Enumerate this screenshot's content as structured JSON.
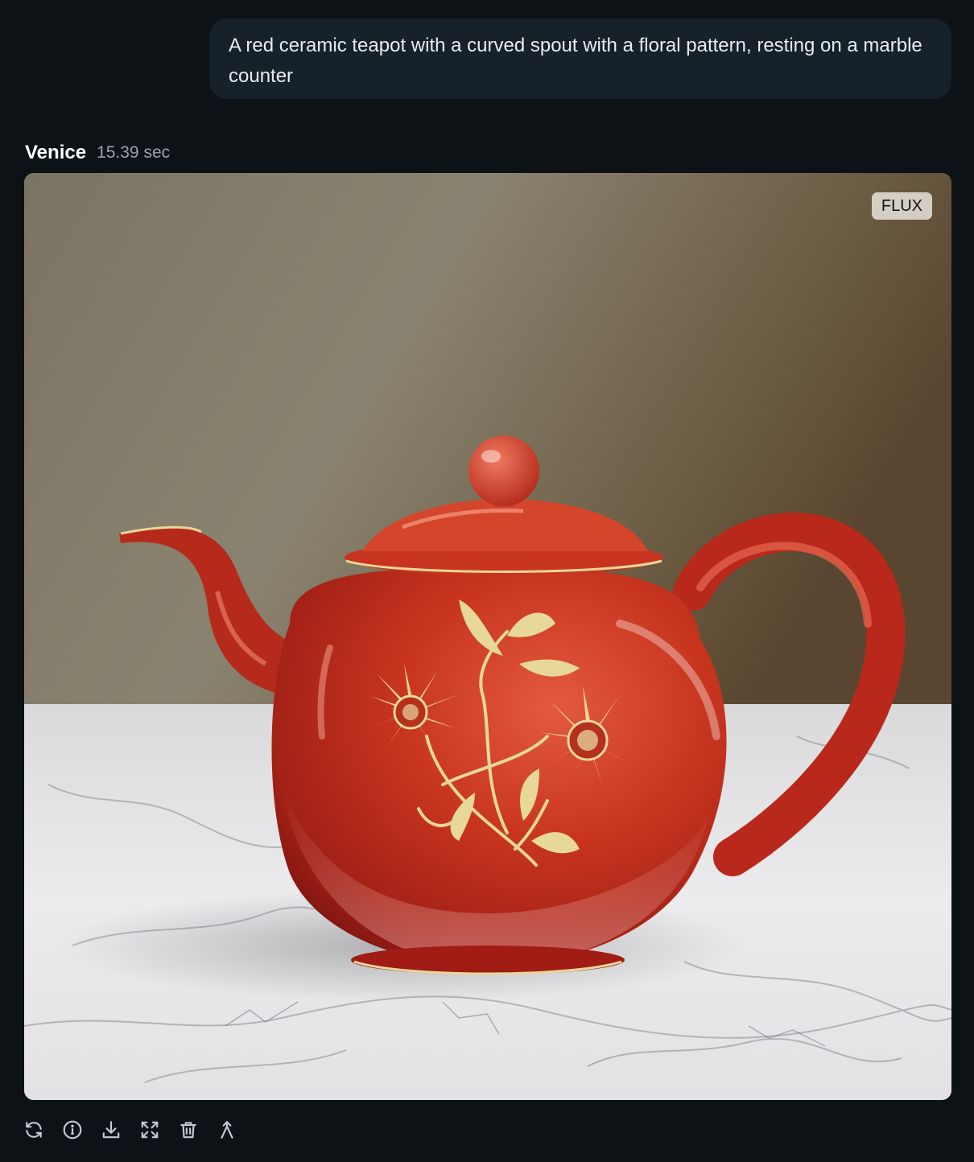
{
  "prompt": {
    "text": "A red ceramic teapot with a curved spout with a floral pattern, resting on a marble counter"
  },
  "response": {
    "author": "Venice",
    "elapsed": "15.39 sec",
    "model_badge": "FLUX"
  },
  "image": {
    "subject": "red glossy teapot with gold floral pattern on white marble counter",
    "teapot_color": "#c0311f",
    "pattern_color": "#e8d79a",
    "wall_color": "#857c67",
    "counter_color": "#e7e6e8"
  },
  "actions": [
    {
      "name": "regenerate",
      "icon": "refresh-icon"
    },
    {
      "name": "info",
      "icon": "info-icon"
    },
    {
      "name": "download",
      "icon": "download-icon"
    },
    {
      "name": "expand",
      "icon": "expand-icon"
    },
    {
      "name": "delete",
      "icon": "trash-icon"
    },
    {
      "name": "upscale",
      "icon": "upscale-icon"
    }
  ],
  "colors": {
    "background": "#0d1217",
    "bubble": "#16212a",
    "text": "#e8edf1",
    "muted": "#9aa3ab",
    "icon": "#c3cad0"
  }
}
